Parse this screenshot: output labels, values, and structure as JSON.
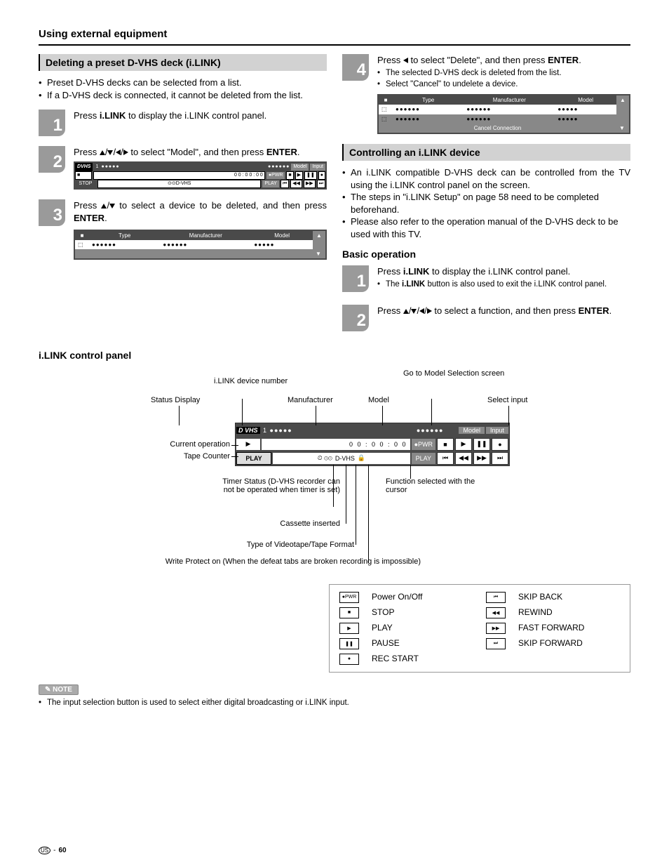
{
  "page_title": "Using external equipment",
  "left": {
    "section": "Deleting a preset D-VHS deck (i.LINK)",
    "bullets": [
      "Preset D-VHS decks can be selected from a list.",
      "If a D-VHS deck is connected, it cannot be deleted from the list."
    ],
    "step1": {
      "n": "1",
      "t1": "Press ",
      "b1": "i.LINK",
      "t2": " to display the i.LINK control panel."
    },
    "step2": {
      "n": "2",
      "t1": "Press ",
      "t2": " to select \"Model\", and then press ",
      "b2": "ENTER",
      "t3": "."
    },
    "step3": {
      "n": "3",
      "t1": "Press ",
      "t2": " to select a device to be deleted, and then press ",
      "b2": "ENTER",
      "t3": "."
    },
    "table3": {
      "h_type": "Type",
      "h_mfr": "Manufacturer",
      "h_model": "Model"
    }
  },
  "right": {
    "step4": {
      "n": "4",
      "t1": "Press ",
      "t2": " to select \"Delete\", and then press ",
      "b2": "ENTER",
      "t3": ".",
      "subs": [
        "The selected D-VHS deck is deleted from the list.",
        "Select \"Cancel\" to undelete a device."
      ]
    },
    "table4": {
      "h_type": "Type",
      "h_mfr": "Manufacturer",
      "h_model": "Model",
      "cancel": "Cancel Connection"
    },
    "section2": "Controlling an i.LINK device",
    "bullets2": [
      "An i.LINK compatible D-VHS deck can be controlled from the TV using the i.LINK control panel on the screen.",
      "The steps in \"i.LINK Setup\" on page 58 need to be completed beforehand.",
      "Please also refer to the operation manual of the D-VHS deck to be used with this TV."
    ],
    "basic": "Basic operation",
    "bstep1": {
      "n": "1",
      "t1": "Press ",
      "b1": "i.LINK",
      "t2": " to display the i.LINK control panel.",
      "subs": [
        "The i.LINK button is also used to exit the i.LINK control panel."
      ],
      "subbold": "i.LINK"
    },
    "bstep2": {
      "n": "2",
      "t1": "Press ",
      "t2": " to select a function, and then press ",
      "b2": "ENTER",
      "t3": "."
    }
  },
  "panel": {
    "heading": "i.LINK control panel",
    "labels": {
      "status": "Status Display",
      "devnum": "i.LINK device number",
      "mfr": "Manufacturer",
      "model": "Model",
      "gotomodel": "Go to Model Selection screen",
      "input": "Select input",
      "curop": "Current operation",
      "tapectr": "Tape Counter",
      "timer": "Timer Status\n(D-VHS recorder can not be operated when timer is set)",
      "func": "Function selected with the cursor",
      "cassette": "Cassette inserted",
      "tapetype": "Type of Videotape/Tape Format",
      "wp": "Write Protect on\n(When the defeat tabs are broken recording is impossible)"
    },
    "osd": {
      "play": "PLAY",
      "pwr": "PWR",
      "model": "Model",
      "input": "Input",
      "counter": "0 0 : 0 0 : 0 0",
      "dvhs": "D-VHS",
      "playsmall": "PLAY",
      "vhs": "VHS",
      "num": "1",
      "stop": "STOP"
    }
  },
  "legend": {
    "pwr": "Power On/Off",
    "stop": "STOP",
    "play": "PLAY",
    "pause": "PAUSE",
    "rec": "REC START",
    "skipb": "SKIP BACK",
    "rew": "REWIND",
    "ff": "FAST FORWARD",
    "skipf": "SKIP FORWARD",
    "pwr_btn": "PWR"
  },
  "note": {
    "badge": "NOTE",
    "text": "The input selection button is used to select either digital broadcasting or i.LINK input."
  },
  "pagenum": "60",
  "region": "US"
}
